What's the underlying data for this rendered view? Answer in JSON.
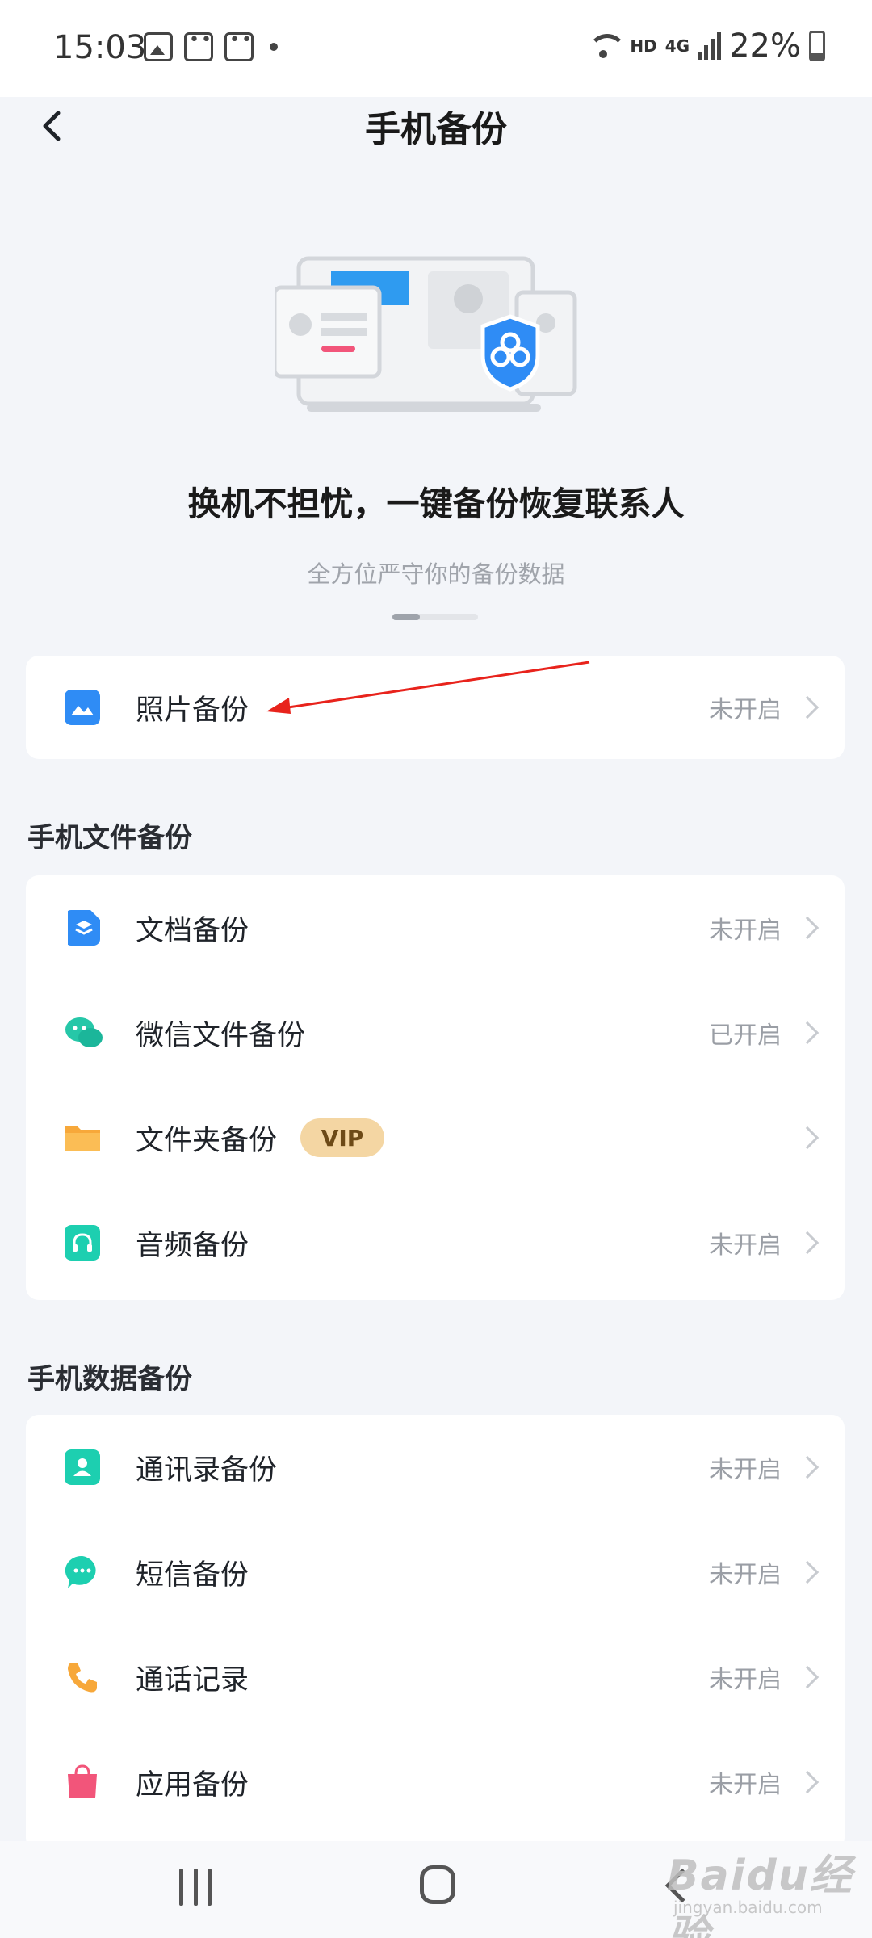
{
  "status_bar": {
    "time": "15:03",
    "network": "HD",
    "network_gen": "4G",
    "battery": "22%"
  },
  "header": {
    "title": "手机备份"
  },
  "hero": {
    "headline": "换机不担忧，一键备份恢复联系人",
    "subtitle": "全方位严守你的备份数据",
    "pager_position": 1,
    "pager_count": 3
  },
  "photo_backup": {
    "label": "照片备份",
    "status": "未开启",
    "icon": "photo-icon",
    "icon_color": "#2f8cf5"
  },
  "file_section": {
    "title": "手机文件备份",
    "items": [
      {
        "label": "文档备份",
        "status": "未开启",
        "icon": "document-icon",
        "icon_color": "#2f8cf5"
      },
      {
        "label": "微信文件备份",
        "status": "已开启",
        "icon": "wechat-icon",
        "icon_color": "#26c7a8"
      },
      {
        "label": "文件夹备份",
        "status": "",
        "badge": "VIP",
        "icon": "folder-icon",
        "icon_color": "#f7a83a"
      },
      {
        "label": "音频备份",
        "status": "未开启",
        "icon": "headphones-icon",
        "icon_color": "#1dcfb0"
      }
    ]
  },
  "data_section": {
    "title": "手机数据备份",
    "items": [
      {
        "label": "通讯录备份",
        "status": "未开启",
        "icon": "contacts-icon",
        "icon_color": "#1dcfb0"
      },
      {
        "label": "短信备份",
        "status": "未开启",
        "icon": "message-icon",
        "icon_color": "#1dcfb0"
      },
      {
        "label": "通话记录",
        "status": "未开启",
        "icon": "phone-icon",
        "icon_color": "#f7a83a"
      },
      {
        "label": "应用备份",
        "status": "未开启",
        "icon": "app-bag-icon",
        "icon_color": "#f2557a"
      }
    ]
  },
  "watermark": {
    "text": "Baidu经验",
    "sub": "jingyan.baidu.com"
  },
  "colors": {
    "background": "#f3f5f9",
    "card": "#ffffff",
    "accent_blue": "#2f8cf5",
    "annotation_red": "#e8231c",
    "vip_bg": "#f4d6a3"
  }
}
